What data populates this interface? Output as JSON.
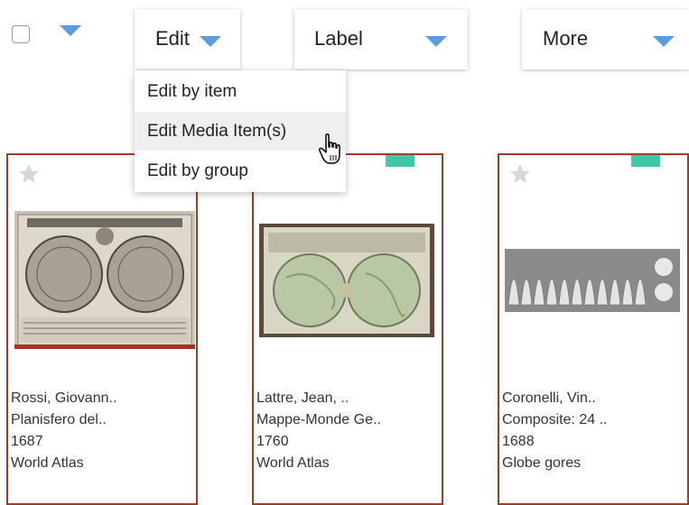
{
  "toolbar": {
    "edit_label": "Edit",
    "label_label": "Label",
    "more_label": "More"
  },
  "dropdown": {
    "items": [
      {
        "label": "Edit by item"
      },
      {
        "label": "Edit Media Item(s)"
      },
      {
        "label": "Edit by group"
      }
    ]
  },
  "cards": [
    {
      "line1": "Rossi, Giovann..",
      "line2": "Planisfero del..",
      "line3": "1687",
      "line4": "World Atlas"
    },
    {
      "line1": "Lattre, Jean, ..",
      "line2": "Mappe-Monde Ge..",
      "line3": "1760",
      "line4": "World Atlas"
    },
    {
      "line1": "Coronelli, Vin..",
      "line2": "Composite: 24 ..",
      "line3": "1688",
      "line4": "Globe gores"
    }
  ],
  "colors": {
    "accent_blue": "#5b9be0",
    "card_border": "#a23b24",
    "tag_teal": "#3ec8a8",
    "hover_bg": "#efefef"
  },
  "icons": {
    "select_all": "checkbox-icon",
    "menu_arrow": "caret-down-icon",
    "favorite": "star-icon",
    "pointer": "hand-cursor-icon"
  }
}
